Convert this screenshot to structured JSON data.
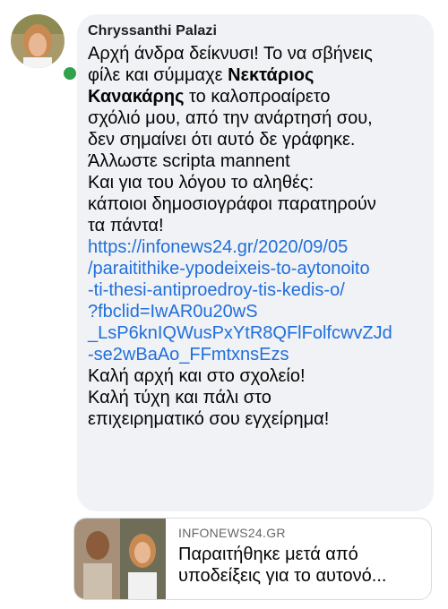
{
  "comment": {
    "author": "Chryssanthi Palazi",
    "status": "online",
    "lines": [
      {
        "text": "Αρχή άνδρα δείκνυσι! Το να σβήνεις"
      },
      {
        "pre": "φίλε και σύμμαχε ",
        "mention": "Νεκτάριος"
      },
      {
        "mention": "Κανακάρης",
        "post": " το καλοπροαίρετο"
      },
      {
        "text": "σχόλιό μου, από την ανάρτησή σου,"
      },
      {
        "text": "δεν σημαίνει ότι αυτό δε γράφηκε."
      },
      {
        "text": "Άλλωστε scripta mannent"
      },
      {
        "text": "Και για του λόγου το αληθές:"
      },
      {
        "text": "κάποιοι δημοσιογράφοι παρατηρούν"
      },
      {
        "text": "τα πάντα!"
      },
      {
        "link": "https://infonews24.gr/2020/09/05"
      },
      {
        "link": "/paraitithike-ypodeixeis-to-aytonoito"
      },
      {
        "link": "-ti-thesi-antiproedroy-tis-kedis-o/"
      },
      {
        "link": "?fbclid=IwAR0u20wS"
      },
      {
        "link": "_LsP6knIQWusPxYtR8QFlFolfcwvZJd"
      },
      {
        "link": "-se2wBaAo_FFmtxnsEzs"
      },
      {
        "text": "Καλή αρχή και στο σχολείο!"
      },
      {
        "text": "Καλή τύχη και πάλι στο"
      },
      {
        "text": "επιχειρηματικό σου εγχείρημα!"
      }
    ]
  },
  "link_preview": {
    "source": "INFONEWS24.GR",
    "title_line1": "Παραιτήθηκε μετά από",
    "title_line2": "υποδείξεις για το αυτονό..."
  },
  "colors": {
    "bubble": "#f0f2f5",
    "link": "#216fdb",
    "online": "#31a24c"
  }
}
